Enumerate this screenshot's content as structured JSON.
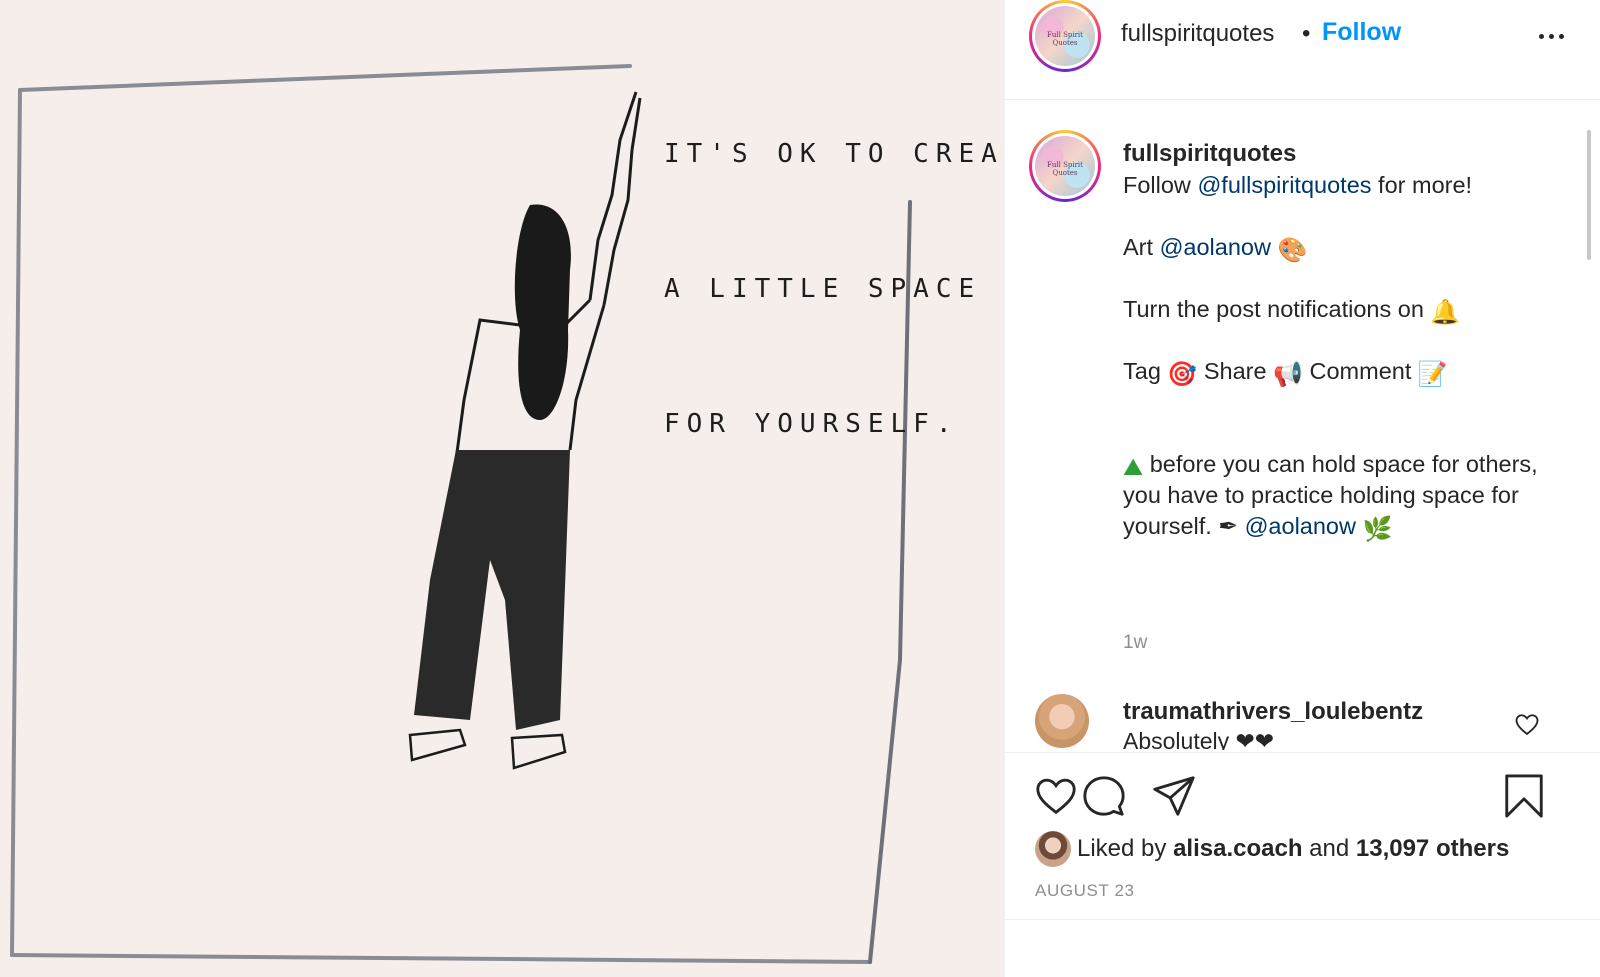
{
  "post": {
    "image": {
      "quote_lines": [
        "IT'S OK TO CREATE",
        "A LITTLE SPACE",
        "FOR YOURSELF."
      ]
    }
  },
  "header": {
    "username": "fullspiritquotes",
    "separator": "•",
    "follow_label": "Follow",
    "more_icon": "more-options-icon"
  },
  "caption": {
    "username": "fullspiritquotes",
    "line1_prefix": "Follow ",
    "line1_mention": "@fullspiritquotes",
    "line1_suffix": " for more!",
    "line2_prefix": "Art ",
    "line2_mention": "@aolanow",
    "line2_emoji": "🎨",
    "line3_text": "Turn the post notifications on ",
    "line3_emoji": "🔔",
    "line4_tag": "Tag ",
    "line4_emoji1": "🎯",
    "line4_share": " Share ",
    "line4_emoji2": "📢",
    "line4_comment": " Comment ",
    "line4_emoji3": "📝",
    "body_emoji": "⛰",
    "body_text": " before you can hold space for others, you have to practice holding space for yourself. ",
    "body_pen": "✒",
    "body_mention": "@aolanow",
    "body_leaf": "🌿",
    "time": "1w"
  },
  "comment": {
    "username": "traumathrivers_loulebentz",
    "text": "Absolutely ❤❤"
  },
  "actions": {
    "liked_prefix": "Liked by ",
    "liked_user": "alisa.coach",
    "liked_mid": " and ",
    "liked_count": "13,097 others",
    "date": "AUGUST 23"
  }
}
